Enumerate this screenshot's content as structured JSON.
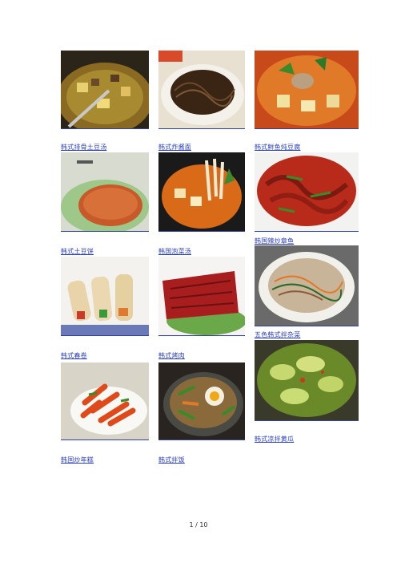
{
  "captions": {
    "c1": "韩式排骨土豆汤",
    "c2": "韩式炸酱面",
    "c3": "韩式鲜鱼炖豆腐",
    "c4": "韩式土豆饼",
    "c5": "韩国泡菜汤",
    "c6": "韩国辣炒章鱼",
    "c7": "韩式春卷",
    "c8": "韩式烤肉",
    "c9": "五色韩式拌杂菜",
    "c10": "韩国炒年糕",
    "c11": "韩式拌饭",
    "c12": "韩式凉拌黄瓜"
  },
  "photos": [
    "pork-rib-potato-soup",
    "black-bean-noodles",
    "fish-tofu-stew",
    "potato-pancake",
    "kimchi-soup",
    "spicy-stir-fried-octopus",
    "spring-rolls",
    "korean-bbq-meat",
    "japchae",
    "tteokbokki",
    "bibimbap",
    "cucumber-salad"
  ],
  "footer": {
    "page": "1  /  10"
  }
}
